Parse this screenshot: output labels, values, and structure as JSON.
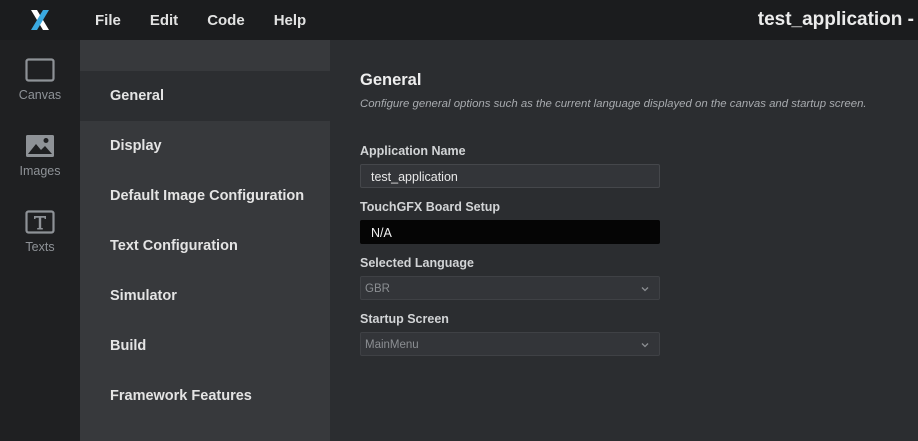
{
  "app": {
    "logo": "X",
    "title": "test_application -"
  },
  "menu": [
    {
      "label": "File"
    },
    {
      "label": "Edit"
    },
    {
      "label": "Code"
    },
    {
      "label": "Help"
    }
  ],
  "rail": [
    {
      "label": "Canvas",
      "icon": "canvas-icon"
    },
    {
      "label": "Images",
      "icon": "image-icon"
    },
    {
      "label": "Texts",
      "icon": "text-icon"
    }
  ],
  "nav": {
    "items": [
      {
        "label": "General",
        "active": true
      },
      {
        "label": "Display"
      },
      {
        "label": "Default Image Configuration"
      },
      {
        "label": "Text Configuration"
      },
      {
        "label": "Simulator"
      },
      {
        "label": "Build"
      },
      {
        "label": "Framework Features"
      }
    ]
  },
  "general": {
    "title": "General",
    "description": "Configure general options such as the current language displayed on the canvas and startup screen.",
    "fields": {
      "app_name": {
        "label": "Application Name",
        "value": "test_application"
      },
      "board_setup": {
        "label": "TouchGFX Board Setup",
        "value": "N/A"
      },
      "language": {
        "label": "Selected Language",
        "value": "GBR"
      },
      "startup_screen": {
        "label": "Startup Screen",
        "value": "MainMenu"
      }
    }
  },
  "colors": {
    "topbar": "#1b1c1e",
    "rail": "#1f2022",
    "nav": "#37393c",
    "content": "#2b2d30",
    "logo_accent": "#3aa9e0"
  }
}
